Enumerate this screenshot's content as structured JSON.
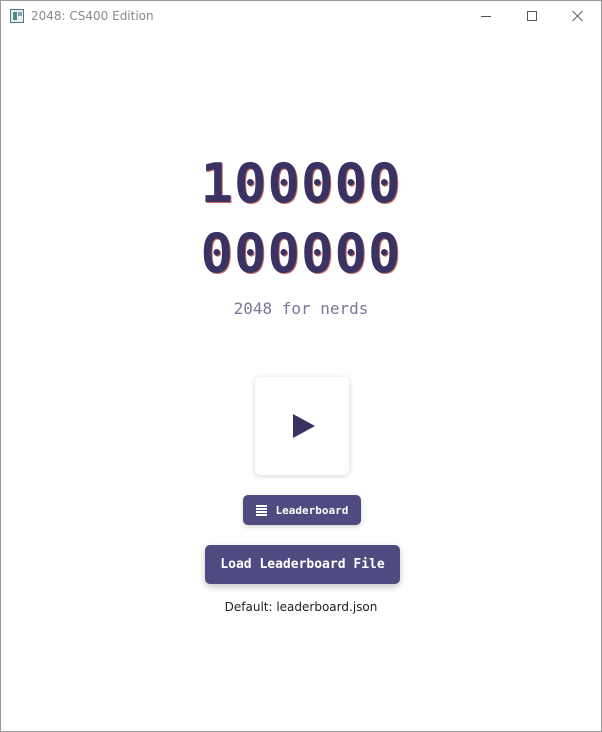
{
  "window": {
    "title": "2048: CS400 Edition",
    "icon": "app-window-icon",
    "controls": [
      "minimize-icon",
      "maximize-icon",
      "close-icon"
    ]
  },
  "hero": {
    "line1": "100000",
    "line2": "000000",
    "subtitle": "2048 for nerds",
    "title_color": "#3a3262",
    "title_shadow_color": "#c66b5c",
    "subtitle_color": "#7d7699"
  },
  "buttons": {
    "play": {
      "icon": "play-icon"
    },
    "leaderboard": {
      "label": "Leaderboard",
      "icon": "list-icon"
    },
    "load_file": {
      "label": "Load Leaderboard File"
    },
    "accent": "#4f4a7f"
  },
  "default_note": "Default: leaderboard.json"
}
